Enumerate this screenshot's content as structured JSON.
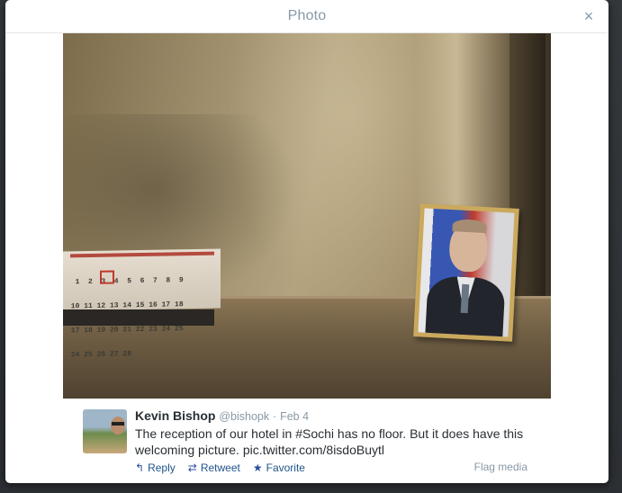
{
  "modal": {
    "title": "Photo",
    "close_symbol": "×"
  },
  "photo": {
    "alt": "Hotel room photo with a calendar and a framed portrait on a shelf",
    "calendar_rows": [
      "  1  2  3  4  5  6  7  8  9",
      " 10 11 12 13 14 15 16 17 18",
      " 17 18 19 20 21 22 23 24 25",
      " 24 25 26 27 28"
    ]
  },
  "tweet": {
    "name": "Kevin Bishop",
    "handle": "@bishopk",
    "separator": "·",
    "date": "Feb 4",
    "text": "The reception of our hotel in #Sochi has no floor. But it does have this welcoming picture. pic.twitter.com/8isdoBuytl"
  },
  "actions": {
    "reply": "Reply",
    "retweet": "Retweet",
    "favorite": "Favorite",
    "flag": "Flag media"
  },
  "icons": {
    "reply": "reply-arrow-icon",
    "retweet": "retweet-icon",
    "favorite": "star-icon",
    "close": "close-icon"
  }
}
